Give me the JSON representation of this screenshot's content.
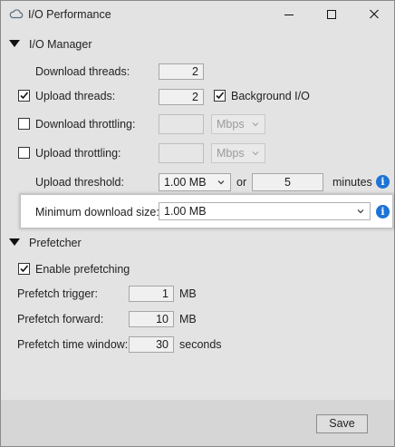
{
  "window": {
    "title": "I/O Performance"
  },
  "io_manager": {
    "header": "I/O Manager",
    "download_threads": {
      "label": "Download threads:",
      "value": "2"
    },
    "upload_threads": {
      "label": "Upload threads:",
      "value": "2",
      "checked": true
    },
    "background_io": {
      "label": "Background I/O",
      "checked": true
    },
    "download_throttling": {
      "label": "Download throttling:",
      "value": "",
      "unit": "Mbps",
      "checked": false
    },
    "upload_throttling": {
      "label": "Upload throttling:",
      "value": "",
      "unit": "Mbps",
      "checked": false
    },
    "upload_threshold": {
      "label": "Upload threshold:",
      "size": "1.00 MB",
      "or": "or",
      "minutes_value": "5",
      "minutes_label": "minutes"
    },
    "minimum_download_size": {
      "label": "Minimum download size:",
      "value": "1.00 MB"
    }
  },
  "prefetcher": {
    "header": "Prefetcher",
    "enable": {
      "label": "Enable prefetching",
      "checked": true
    },
    "trigger": {
      "label": "Prefetch trigger:",
      "value": "1",
      "unit": "MB"
    },
    "forward": {
      "label": "Prefetch forward:",
      "value": "10",
      "unit": "MB"
    },
    "time_window": {
      "label": "Prefetch time window:",
      "value": "30",
      "unit": "seconds"
    }
  },
  "footer": {
    "save_label": "Save"
  },
  "colors": {
    "info_blue": "#1c74d4",
    "window_bg": "#e3e3e3"
  },
  "icons": {
    "app": "cloud-icon",
    "info": "info-icon"
  }
}
